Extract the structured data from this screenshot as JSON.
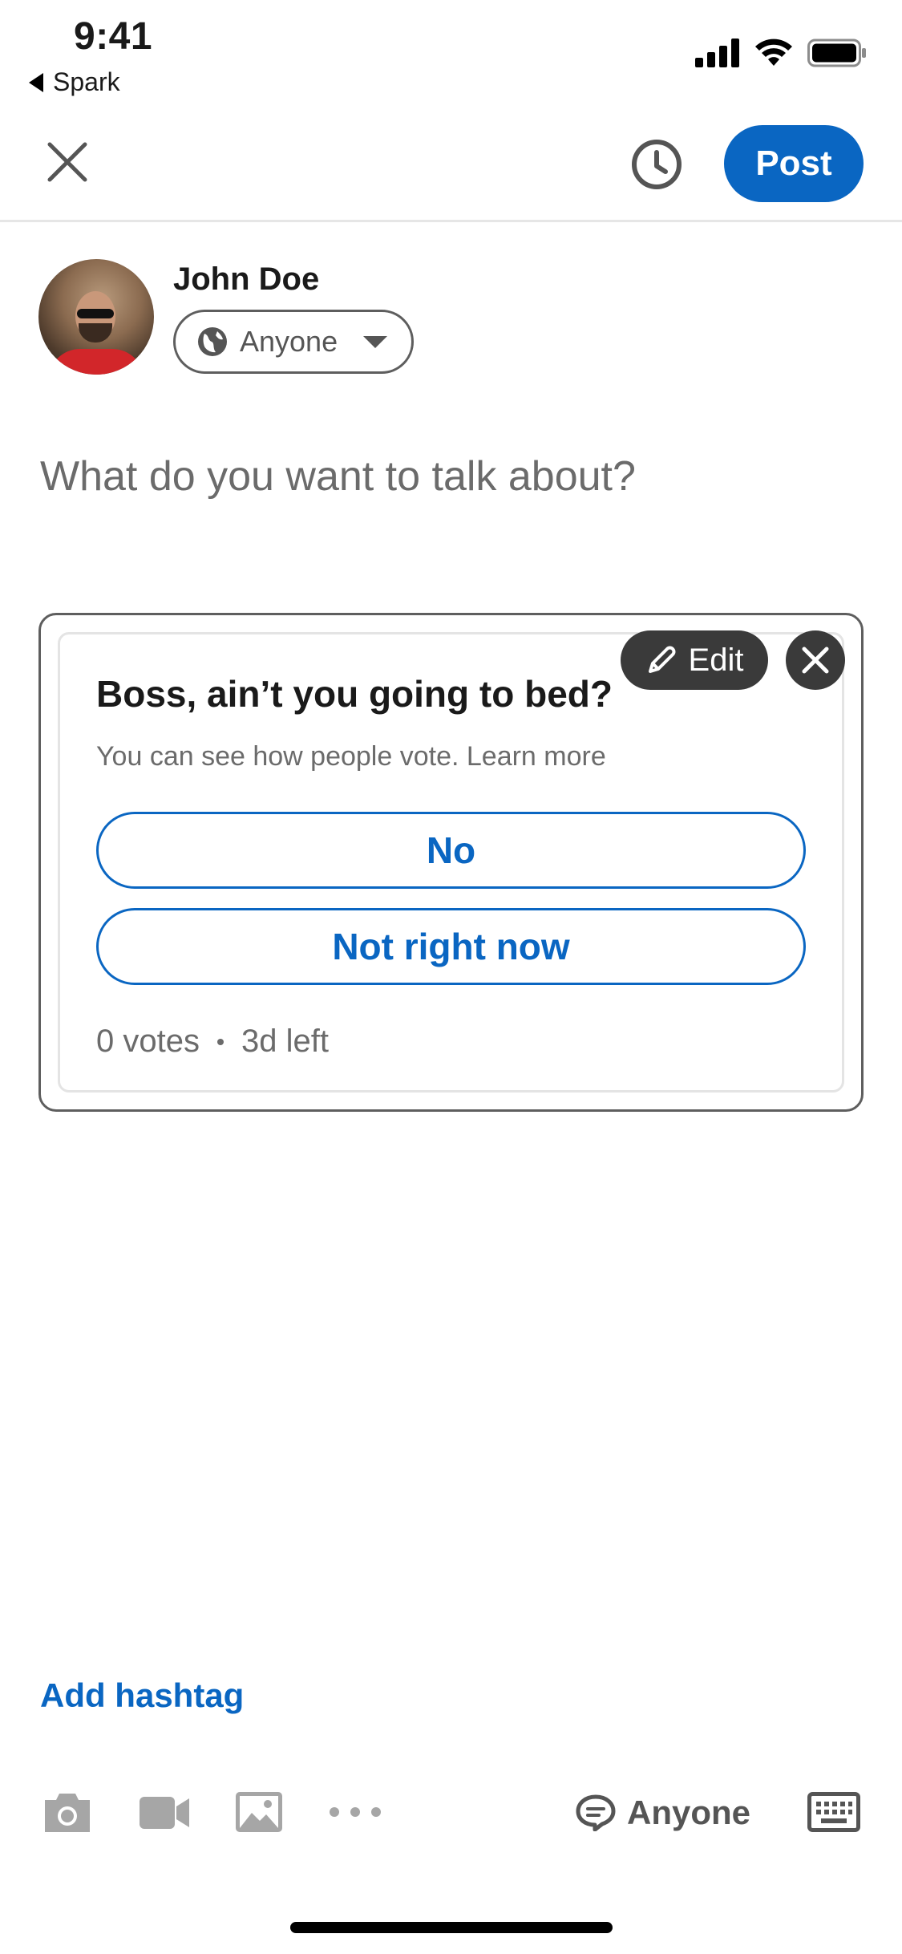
{
  "status_bar": {
    "time": "9:41",
    "back_app": "Spark"
  },
  "header": {
    "close_icon": "close-icon",
    "schedule_icon": "clock-icon",
    "post_label": "Post",
    "accent_color": "#0a66c2"
  },
  "author": {
    "name": "John Doe",
    "audience": "Anyone"
  },
  "composer": {
    "placeholder": "What do you want to talk about?"
  },
  "poll": {
    "question": "Boss, ain’t you going to bed?",
    "note": "You can see how people vote. Learn more",
    "options": [
      "No",
      "Not right now"
    ],
    "votes": "0 votes",
    "time_left": "3d left",
    "edit_label": "Edit"
  },
  "footer": {
    "add_hashtag": "Add hashtag",
    "comment_audience": "Anyone",
    "icons": [
      "camera-icon",
      "video-icon",
      "photo-icon",
      "more-icon",
      "comment-icon",
      "keyboard-icon"
    ]
  }
}
